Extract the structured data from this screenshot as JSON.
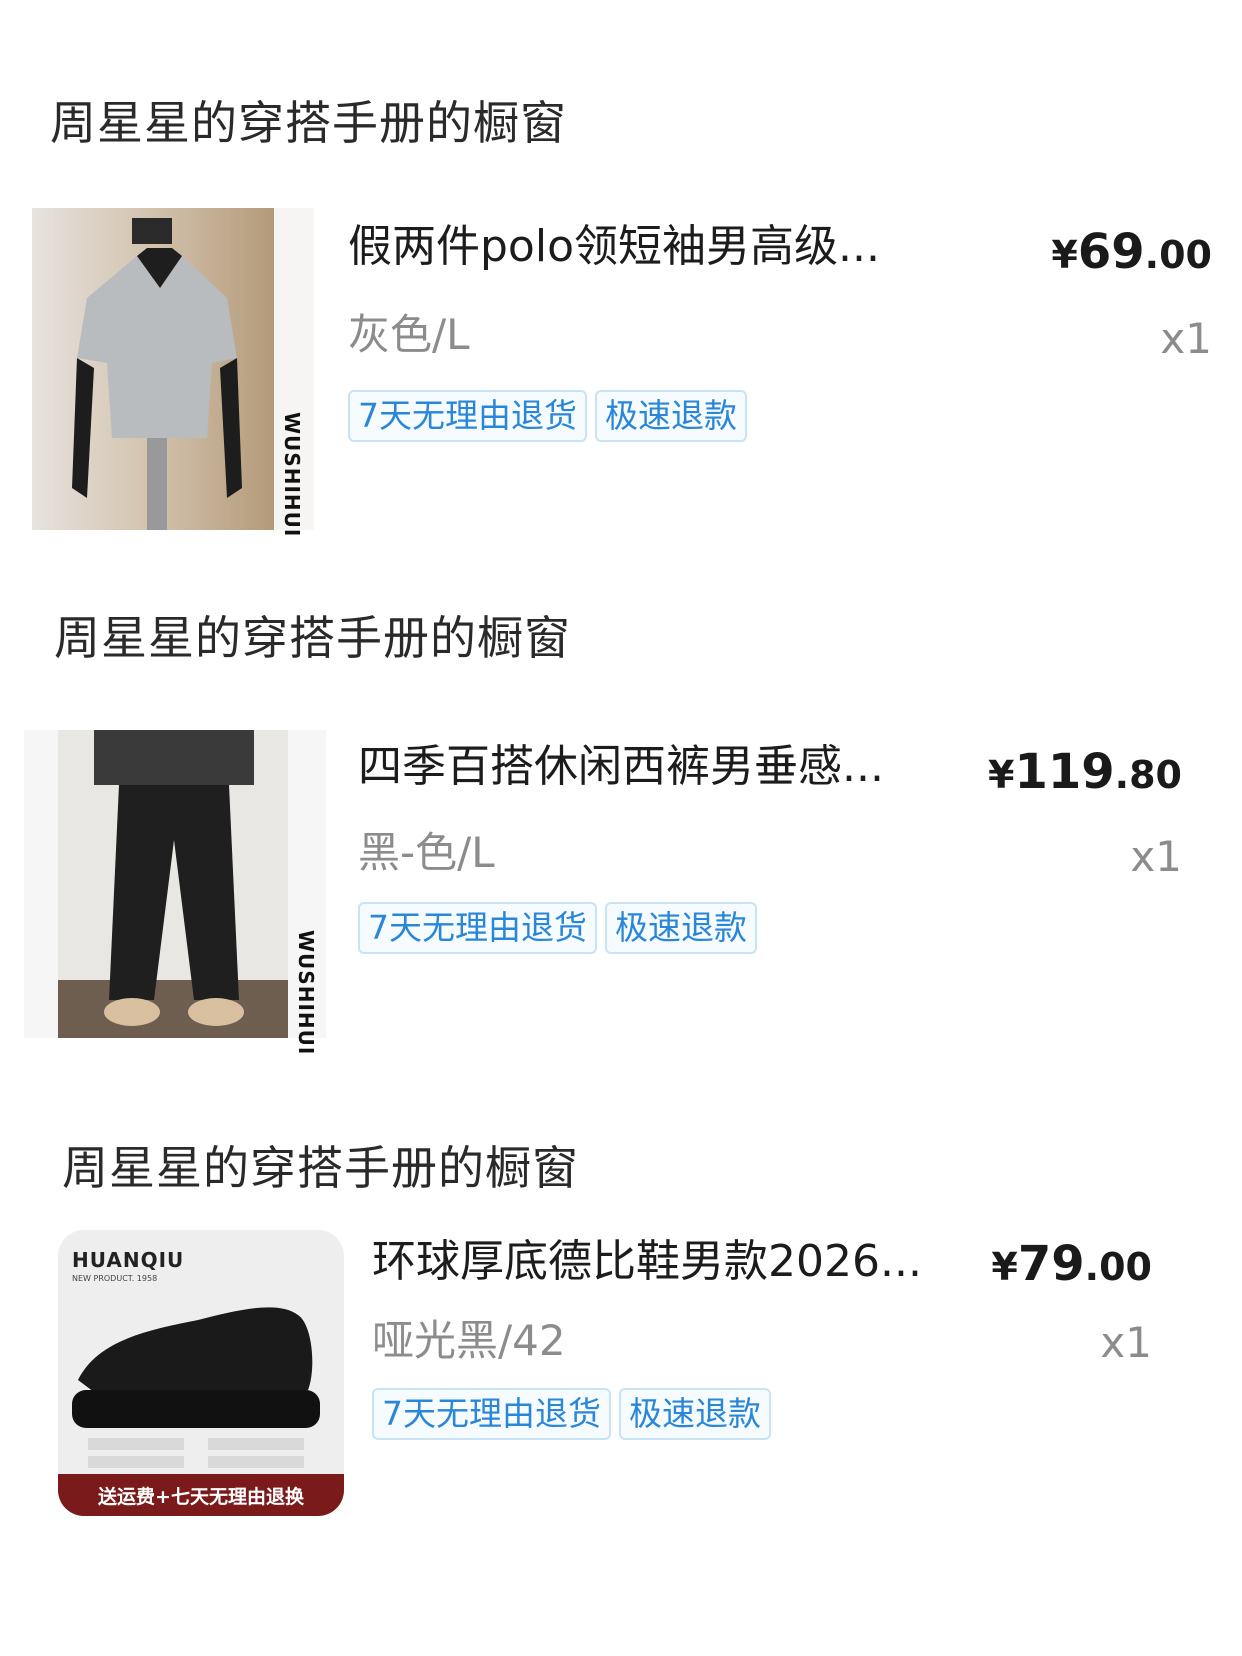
{
  "orders": [
    {
      "shop": "周星星的穿搭手册的橱窗",
      "title": "假两件polo领短袖男高级...",
      "price_yen": "¥",
      "price_int": "69",
      "price_dec": ".00",
      "variant": "灰色/L",
      "qty": "x1",
      "tags": [
        "7天无理由退货",
        "极速退款"
      ],
      "image_text": "WUSHIHUI"
    },
    {
      "shop": "周星星的穿搭手册的橱窗",
      "title": "四季百搭休闲西裤男垂感...",
      "price_yen": "¥",
      "price_int": "119",
      "price_dec": ".80",
      "variant": "黑-色/L",
      "qty": "x1",
      "tags": [
        "7天无理由退货",
        "极速退款"
      ],
      "image_text": "WUSHIHUI"
    },
    {
      "shop": "周星星的穿搭手册的橱窗",
      "title": "环球厚底德比鞋男款2026...",
      "price_yen": "¥",
      "price_int": "79",
      "price_dec": ".00",
      "variant": "哑光黑/42",
      "qty": "x1",
      "tags": [
        "7天无理由退货",
        "极速退款"
      ],
      "image_text": {
        "brand": "HUANQIU",
        "sub": "NEW PRODUCT. 1958",
        "banner": "送运费+七天无理由退换"
      }
    }
  ]
}
